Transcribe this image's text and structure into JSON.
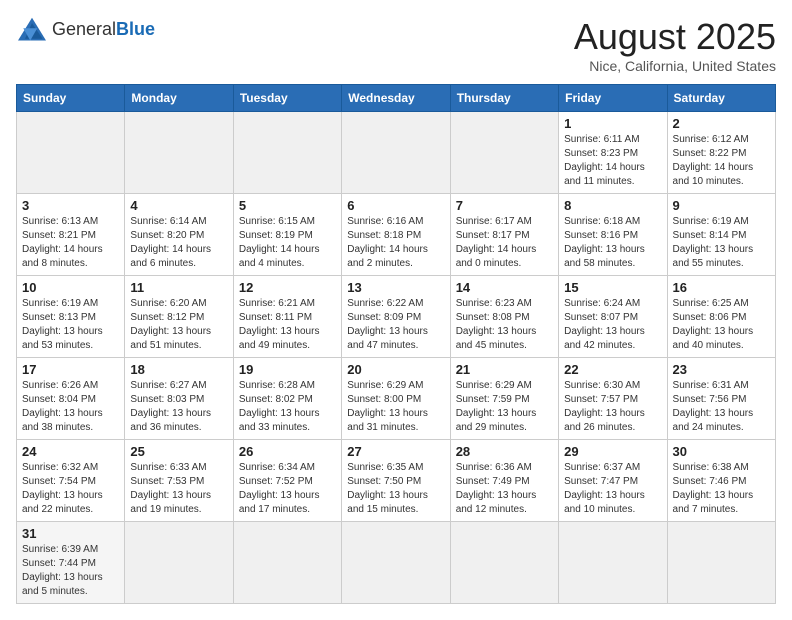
{
  "header": {
    "logo_general": "General",
    "logo_blue": "Blue",
    "title": "August 2025",
    "subtitle": "Nice, California, United States"
  },
  "days_of_week": [
    "Sunday",
    "Monday",
    "Tuesday",
    "Wednesday",
    "Thursday",
    "Friday",
    "Saturday"
  ],
  "weeks": [
    [
      {
        "day": "",
        "info": ""
      },
      {
        "day": "",
        "info": ""
      },
      {
        "day": "",
        "info": ""
      },
      {
        "day": "",
        "info": ""
      },
      {
        "day": "",
        "info": ""
      },
      {
        "day": "1",
        "info": "Sunrise: 6:11 AM\nSunset: 8:23 PM\nDaylight: 14 hours and 11 minutes."
      },
      {
        "day": "2",
        "info": "Sunrise: 6:12 AM\nSunset: 8:22 PM\nDaylight: 14 hours and 10 minutes."
      }
    ],
    [
      {
        "day": "3",
        "info": "Sunrise: 6:13 AM\nSunset: 8:21 PM\nDaylight: 14 hours and 8 minutes."
      },
      {
        "day": "4",
        "info": "Sunrise: 6:14 AM\nSunset: 8:20 PM\nDaylight: 14 hours and 6 minutes."
      },
      {
        "day": "5",
        "info": "Sunrise: 6:15 AM\nSunset: 8:19 PM\nDaylight: 14 hours and 4 minutes."
      },
      {
        "day": "6",
        "info": "Sunrise: 6:16 AM\nSunset: 8:18 PM\nDaylight: 14 hours and 2 minutes."
      },
      {
        "day": "7",
        "info": "Sunrise: 6:17 AM\nSunset: 8:17 PM\nDaylight: 14 hours and 0 minutes."
      },
      {
        "day": "8",
        "info": "Sunrise: 6:18 AM\nSunset: 8:16 PM\nDaylight: 13 hours and 58 minutes."
      },
      {
        "day": "9",
        "info": "Sunrise: 6:19 AM\nSunset: 8:14 PM\nDaylight: 13 hours and 55 minutes."
      }
    ],
    [
      {
        "day": "10",
        "info": "Sunrise: 6:19 AM\nSunset: 8:13 PM\nDaylight: 13 hours and 53 minutes."
      },
      {
        "day": "11",
        "info": "Sunrise: 6:20 AM\nSunset: 8:12 PM\nDaylight: 13 hours and 51 minutes."
      },
      {
        "day": "12",
        "info": "Sunrise: 6:21 AM\nSunset: 8:11 PM\nDaylight: 13 hours and 49 minutes."
      },
      {
        "day": "13",
        "info": "Sunrise: 6:22 AM\nSunset: 8:09 PM\nDaylight: 13 hours and 47 minutes."
      },
      {
        "day": "14",
        "info": "Sunrise: 6:23 AM\nSunset: 8:08 PM\nDaylight: 13 hours and 45 minutes."
      },
      {
        "day": "15",
        "info": "Sunrise: 6:24 AM\nSunset: 8:07 PM\nDaylight: 13 hours and 42 minutes."
      },
      {
        "day": "16",
        "info": "Sunrise: 6:25 AM\nSunset: 8:06 PM\nDaylight: 13 hours and 40 minutes."
      }
    ],
    [
      {
        "day": "17",
        "info": "Sunrise: 6:26 AM\nSunset: 8:04 PM\nDaylight: 13 hours and 38 minutes."
      },
      {
        "day": "18",
        "info": "Sunrise: 6:27 AM\nSunset: 8:03 PM\nDaylight: 13 hours and 36 minutes."
      },
      {
        "day": "19",
        "info": "Sunrise: 6:28 AM\nSunset: 8:02 PM\nDaylight: 13 hours and 33 minutes."
      },
      {
        "day": "20",
        "info": "Sunrise: 6:29 AM\nSunset: 8:00 PM\nDaylight: 13 hours and 31 minutes."
      },
      {
        "day": "21",
        "info": "Sunrise: 6:29 AM\nSunset: 7:59 PM\nDaylight: 13 hours and 29 minutes."
      },
      {
        "day": "22",
        "info": "Sunrise: 6:30 AM\nSunset: 7:57 PM\nDaylight: 13 hours and 26 minutes."
      },
      {
        "day": "23",
        "info": "Sunrise: 6:31 AM\nSunset: 7:56 PM\nDaylight: 13 hours and 24 minutes."
      }
    ],
    [
      {
        "day": "24",
        "info": "Sunrise: 6:32 AM\nSunset: 7:54 PM\nDaylight: 13 hours and 22 minutes."
      },
      {
        "day": "25",
        "info": "Sunrise: 6:33 AM\nSunset: 7:53 PM\nDaylight: 13 hours and 19 minutes."
      },
      {
        "day": "26",
        "info": "Sunrise: 6:34 AM\nSunset: 7:52 PM\nDaylight: 13 hours and 17 minutes."
      },
      {
        "day": "27",
        "info": "Sunrise: 6:35 AM\nSunset: 7:50 PM\nDaylight: 13 hours and 15 minutes."
      },
      {
        "day": "28",
        "info": "Sunrise: 6:36 AM\nSunset: 7:49 PM\nDaylight: 13 hours and 12 minutes."
      },
      {
        "day": "29",
        "info": "Sunrise: 6:37 AM\nSunset: 7:47 PM\nDaylight: 13 hours and 10 minutes."
      },
      {
        "day": "30",
        "info": "Sunrise: 6:38 AM\nSunset: 7:46 PM\nDaylight: 13 hours and 7 minutes."
      }
    ],
    [
      {
        "day": "31",
        "info": "Sunrise: 6:39 AM\nSunset: 7:44 PM\nDaylight: 13 hours and 5 minutes."
      },
      {
        "day": "",
        "info": ""
      },
      {
        "day": "",
        "info": ""
      },
      {
        "day": "",
        "info": ""
      },
      {
        "day": "",
        "info": ""
      },
      {
        "day": "",
        "info": ""
      },
      {
        "day": "",
        "info": ""
      }
    ]
  ]
}
